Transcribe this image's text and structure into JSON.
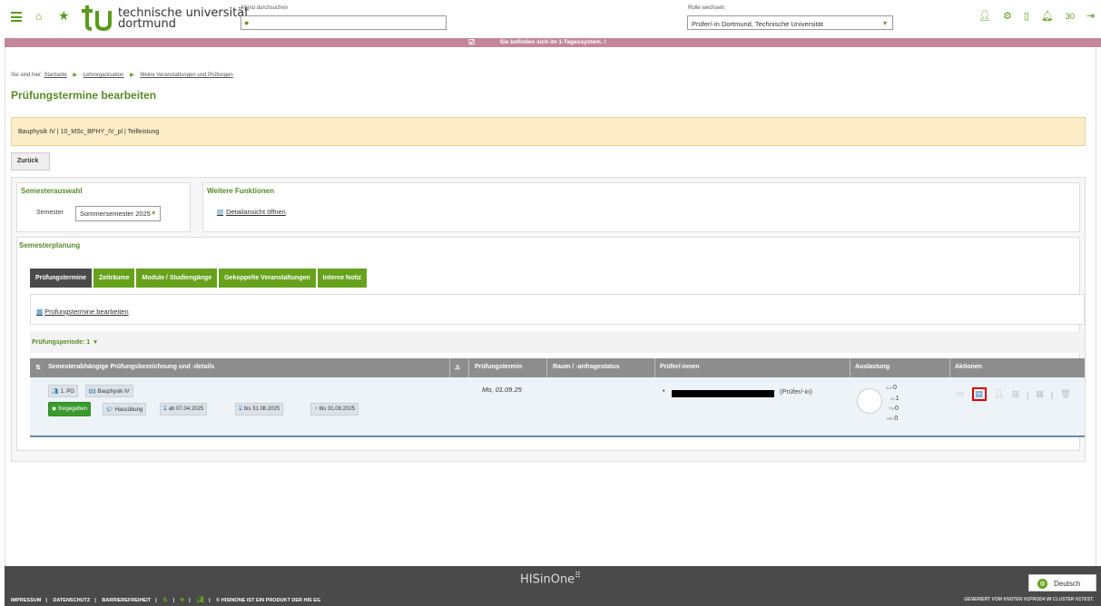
{
  "header": {
    "university_line1": "technische universität",
    "university_line2": "dortmund",
    "search_label": "Menü durchsuchen",
    "role_label": "Rolle wechseln",
    "role_value": "Prüfer/-in Dortmund, Technische Universität",
    "notification_count": "30"
  },
  "notice": "Sie befinden sich im 1-Tagessystem. /",
  "breadcrumb": {
    "prefix": "Sie sind hier:",
    "items": [
      "Startseite",
      "Lehrorganisation",
      "Meine Veranstaltungen und Prüfungen"
    ]
  },
  "page_title": "Prüfungstermine bearbeiten",
  "info_bar": "Bauphysik IV | 10_MSc_BPHY_IV_pl | Teilleistung",
  "back_label": "Zurück",
  "semester": {
    "title": "Semesterauswahl",
    "label": "Semester",
    "value": "Sommersemester 2025"
  },
  "functions": {
    "title": "Weitere Funktionen",
    "detail_link": "Detailansicht öffnen"
  },
  "planning": {
    "title": "Semesterplanung",
    "tabs": [
      "Prüfungstermine",
      "Zeiträume",
      "Module / Studiengänge",
      "Gekoppelte Veranstaltungen",
      "Interne Notiz"
    ],
    "edit_link": "Prüfungstermine bearbeiten",
    "period": "Prüfungsperiode: 1"
  },
  "table": {
    "headers": [
      "Semesterabhängige Prüfungsbezeichnung und -details",
      "Prüfungstermin",
      "Raum / -anfragestatus",
      "Prüfer/-innen",
      "Auslastung",
      "Aktionen"
    ],
    "row": {
      "pg": "1. PG",
      "course": "Bauphysik IV",
      "status": "freigegeben",
      "type": "Hausübung",
      "from": "ab 07.04.2025",
      "until": "bis 31.08.2025",
      "deadline": "bis 31.08.2025",
      "date": "Mo, 01.09.25",
      "examiner_role": "(Prüfer/-in)",
      "capacity": [
        {
          "label": "zuv",
          "value": "0"
        },
        {
          "label": "zu",
          "value": "1"
        },
        {
          "label": "TN",
          "value": "0"
        },
        {
          "label": "WE",
          "value": "0"
        }
      ]
    }
  },
  "footer": {
    "logo": "HISinOne",
    "links": [
      "IMPRESSUM",
      "DATENSCHUTZ",
      "BARRIEREFREIHEIT"
    ],
    "product": "© HISINONE IST EIN PRODUKT DER HIS EG",
    "generated": "GENERIERT VOM KNOTEN H1PROD4 IM CLUSTER H1TEST.",
    "language": "Deutsch"
  },
  "colors": {
    "accent": "#66a21c",
    "notice": "#c2879a",
    "info": "#fdedc6"
  }
}
